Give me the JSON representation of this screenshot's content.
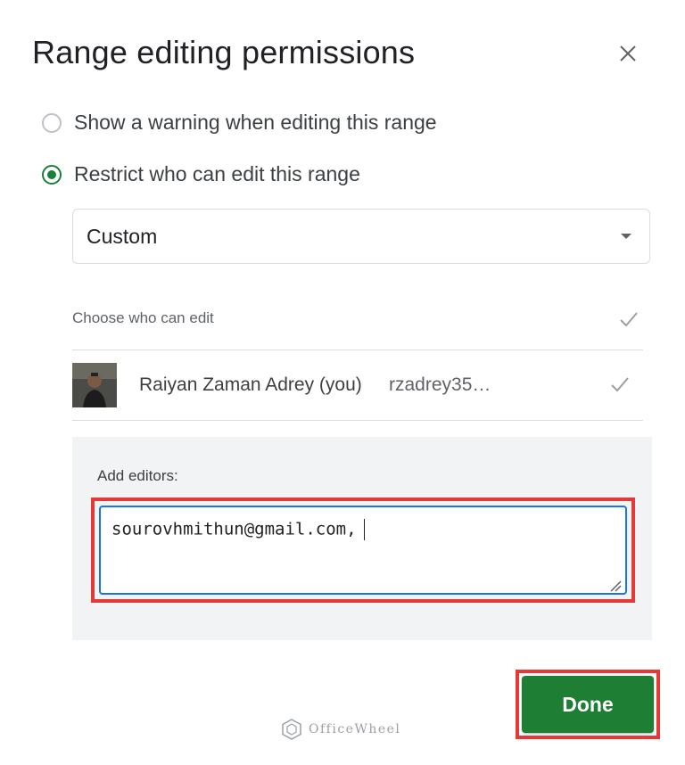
{
  "dialog": {
    "title": "Range editing permissions"
  },
  "options": {
    "warning_label": "Show a warning when editing this range",
    "restrict_label": "Restrict who can edit this range",
    "selected": "restrict"
  },
  "permission_select": {
    "value": "Custom"
  },
  "editors": {
    "choose_label": "Choose who can edit",
    "users": [
      {
        "name": "Raiyan Zaman Adrey (you)",
        "email": "rzadrey35…",
        "checked": true
      }
    ],
    "add_label": "Add editors:",
    "input_value": "sourovhmithun@gmail.com,"
  },
  "actions": {
    "done_label": "Done"
  },
  "watermark": {
    "text": "OfficeWheel"
  },
  "colors": {
    "accent_green": "#188038",
    "button_green": "#1e7e34",
    "focus_blue": "#1a73e8",
    "highlight_red": "#e53935"
  }
}
